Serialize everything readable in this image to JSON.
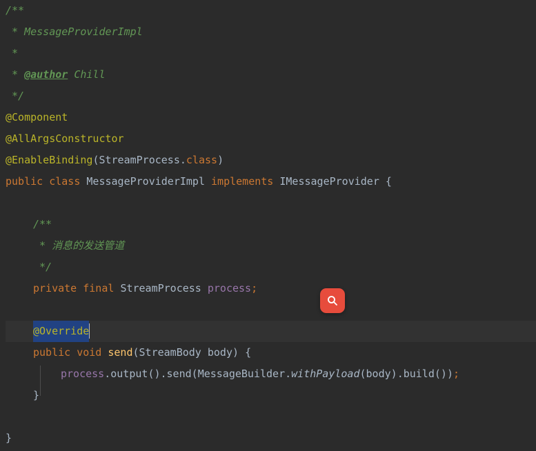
{
  "doc": {
    "open": "/**",
    "line1": " * MessageProviderImpl",
    "blank": " *",
    "author_prefix": " * ",
    "author_tag": "@author",
    "author_name": " Chill",
    "close": " */"
  },
  "ann": {
    "component": "@Component",
    "all_args": "@AllArgsConstructor",
    "enable_binding": "@EnableBinding",
    "override": "@Override"
  },
  "sig": {
    "public": "public",
    "class": "class",
    "name": "MessageProviderImpl",
    "implements": "implements",
    "iface": "IMessageProvider",
    "stream_process": "StreamProcess",
    "dot": ".",
    "cls": "class",
    "open_brace": "{",
    "close_brace": "}",
    "open_paren": "(",
    "close_paren": ")"
  },
  "field_doc": {
    "open": "/**",
    "line": " * 消息的发送管道",
    "close": " */"
  },
  "field": {
    "private": "private",
    "final": "final",
    "type": "StreamProcess",
    "name": "process",
    "semi": ";"
  },
  "method": {
    "public": "public",
    "void": "void",
    "name": "send",
    "param_type": "StreamBody",
    "param_name": "body",
    "open_brace": "{",
    "close_brace": "}"
  },
  "body": {
    "process": "process",
    "output": "output",
    "send": "send",
    "builder": "MessageBuilder",
    "with_payload": "withPayload",
    "arg": "body",
    "build": "build",
    "dot": ".",
    "op": "(",
    "cp": ")",
    "semi": ";"
  },
  "icons": {
    "search": "search-icon"
  }
}
